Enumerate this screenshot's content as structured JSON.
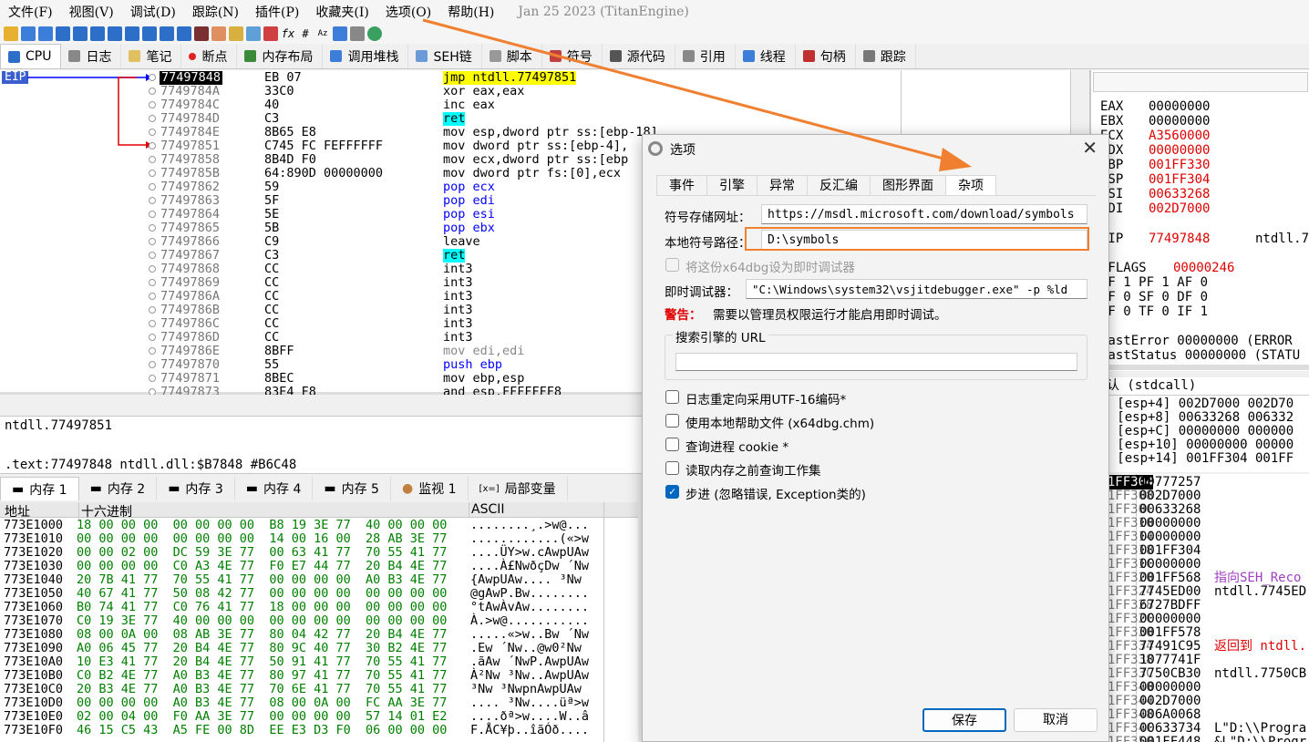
{
  "menu": [
    "文件(F)",
    "视图(V)",
    "调试(D)",
    "跟踪(N)",
    "插件(P)",
    "收藏夹(I)",
    "选项(O)",
    "帮助(H)"
  ],
  "build": "Jan 25 2023 (TitanEngine)",
  "tabs": [
    "CPU",
    "日志",
    "笔记",
    "断点",
    "内存布局",
    "调用堆栈",
    "SEH链",
    "脚本",
    "符号",
    "源代码",
    "引用",
    "线程",
    "句柄",
    "跟踪"
  ],
  "eip_label": "EIP",
  "disasm": [
    {
      "addr": "77497848",
      "bytes": "EB 07",
      "ins": "jmp ntdll.77497851"
    },
    {
      "addr": "7749784A",
      "bytes": "33C0",
      "ins": "xor eax,eax"
    },
    {
      "addr": "7749784C",
      "bytes": "40",
      "ins": "inc eax"
    },
    {
      "addr": "7749784D",
      "bytes": "C3",
      "ins": "ret"
    },
    {
      "addr": "7749784E",
      "bytes": "8B65 E8",
      "ins": "mov esp,dword ptr ss:[ebp-18]"
    },
    {
      "addr": "77497851",
      "bytes": "C745 FC FEFFFFFF",
      "ins": "mov dword ptr ss:[ebp-4],"
    },
    {
      "addr": "77497858",
      "bytes": "8B4D F0",
      "ins": "mov ecx,dword ptr ss:[ebp"
    },
    {
      "addr": "7749785B",
      "bytes": "64:890D 00000000",
      "ins": "mov dword ptr fs:[0],ecx"
    },
    {
      "addr": "77497862",
      "bytes": "59",
      "ins": "pop ecx"
    },
    {
      "addr": "77497863",
      "bytes": "5F",
      "ins": "pop edi"
    },
    {
      "addr": "77497864",
      "bytes": "5E",
      "ins": "pop esi"
    },
    {
      "addr": "77497865",
      "bytes": "5B",
      "ins": "pop ebx"
    },
    {
      "addr": "77497866",
      "bytes": "C9",
      "ins": "leave"
    },
    {
      "addr": "77497867",
      "bytes": "C3",
      "ins": "ret"
    },
    {
      "addr": "77497868",
      "bytes": "CC",
      "ins": "int3"
    },
    {
      "addr": "77497869",
      "bytes": "CC",
      "ins": "int3"
    },
    {
      "addr": "7749786A",
      "bytes": "CC",
      "ins": "int3"
    },
    {
      "addr": "7749786B",
      "bytes": "CC",
      "ins": "int3"
    },
    {
      "addr": "7749786C",
      "bytes": "CC",
      "ins": "int3"
    },
    {
      "addr": "7749786D",
      "bytes": "CC",
      "ins": "int3"
    },
    {
      "addr": "7749786E",
      "bytes": "8BFF",
      "ins": "mov edi,edi"
    },
    {
      "addr": "77497870",
      "bytes": "55",
      "ins": "push ebp"
    },
    {
      "addr": "77497871",
      "bytes": "8BEC",
      "ins": "mov ebp,esp"
    },
    {
      "addr": "77497873",
      "bytes": "83E4 F8",
      "ins": "and esp,FFFFFFF8"
    }
  ],
  "info": {
    "line1": "ntdll.77497851",
    "line2": ".text:77497848 ntdll.dll:$B7848 #B6C48"
  },
  "memtabs": [
    "内存 1",
    "内存 2",
    "内存 3",
    "内存 4",
    "内存 5",
    "监视 1",
    "局部变量"
  ],
  "dump_header": {
    "addr": "地址",
    "hex": "十六进制",
    "ascii": "ASCII"
  },
  "dump": [
    {
      "a": "773E1000",
      "h": "18 00 00 00  00 00 00 00  B8 19 3E 77  40 00 00 00",
      "s": "........¸.>w@..."
    },
    {
      "a": "773E1010",
      "h": "00 00 00 00  00 00 00 00  14 00 16 00  28 AB 3E 77",
      "s": "............(«>w"
    },
    {
      "a": "773E1020",
      "h": "00 00 02 00  DC 59 3E 77  00 63 41 77  70 55 41 77",
      "s": "....ÜY>w.cAwpUAw"
    },
    {
      "a": "773E1030",
      "h": "00 00 00 00  C0 A3 4E 77  F0 E7 44 77  20 B4 4E 77",
      "s": "....À£NwðçDw ´Nw"
    },
    {
      "a": "773E1040",
      "h": "20 7B 41 77  70 55 41 77  00 00 00 00  A0 B3 4E 77",
      "s": " {AwpUAw.... ³Nw"
    },
    {
      "a": "773E1050",
      "h": "40 67 41 77  50 08 42 77  00 00 00 00  00 00 00 00",
      "s": "@gAwP.Bw........"
    },
    {
      "a": "773E1060",
      "h": "B0 74 41 77  C0 76 41 77  18 00 00 00  00 00 00 00",
      "s": "°tAwÀvAw........"
    },
    {
      "a": "773E1070",
      "h": "C0 19 3E 77  40 00 00 00  00 00 00 00  00 00 00 00",
      "s": "À.>w@..........."
    },
    {
      "a": "773E1080",
      "h": "08 00 0A 00  08 AB 3E 77  80 04 42 77  20 B4 4E 77",
      "s": ".....«>w..Bw ´Nw"
    },
    {
      "a": "773E1090",
      "h": "A0 06 45 77  20 B4 4E 77  80 9C 40 77  30 B2 4E 77",
      "s": " .Ew ´Nw..@w0²Nw"
    },
    {
      "a": "773E10A0",
      "h": "10 E3 41 77  20 B4 4E 77  50 91 41 77  70 55 41 77",
      "s": ".ãAw ´NwP.AwpUAw"
    },
    {
      "a": "773E10B0",
      "h": "C0 B2 4E 77  A0 B3 4E 77  80 97 41 77  70 55 41 77",
      "s": "À²Nw ³Nw..AwpUAw"
    },
    {
      "a": "773E10C0",
      "h": "20 B3 4E 77  A0 B3 4E 77  70 6E 41 77  70 55 41 77",
      "s": " ³Nw ³NwpnAwpUAw"
    },
    {
      "a": "773E10D0",
      "h": "00 00 00 00  A0 B3 4E 77  08 00 0A 00  FC AA 3E 77",
      "s": ".... ³Nw....üª>w"
    },
    {
      "a": "773E10E0",
      "h": "02 00 04 00  F0 AA 3E 77  00 00 00 00  57 14 01 E2",
      "s": "....ðª>w....W..â"
    },
    {
      "a": "773E10F0",
      "h": "46 15 C5 43  A5 FE 00 8D  EE E3 D3 F0  06 00 00 00",
      "s": "F.ÅC¥þ..îãÓð...."
    }
  ],
  "regs": [
    {
      "n": "EAX",
      "v": "00000000"
    },
    {
      "n": "EBX",
      "v": "00000000"
    },
    {
      "n": "ECX",
      "v": "A3560000"
    },
    {
      "n": "EDX",
      "v": "00000000"
    },
    {
      "n": "EBP",
      "v": "001FF330"
    },
    {
      "n": "ESP",
      "v": "001FF304"
    },
    {
      "n": "ESI",
      "v": "00633268"
    },
    {
      "n": "EDI",
      "v": "002D7000"
    }
  ],
  "eip": {
    "n": "EIP",
    "v": "77497848",
    "sym": "ntdll.7"
  },
  "eflags": {
    "n": "EFLAGS",
    "v": "00000246"
  },
  "flags": [
    "ZF 1  PF 1  AF 0",
    "OF 0  SF 0  DF 0",
    "CF 0  TF 0  IF 1"
  ],
  "lasterr": [
    "LastError  00000000 (ERROR",
    "LastStatus 00000000 (STATU"
  ],
  "callconv": "默认 (stdcall)",
  "args": [
    "1: [esp+4]  002D7000 002D70",
    "2: [esp+8]  00633268 006332",
    "3: [esp+C]  00000000 000000",
    "4: [esp+10]  00000000 00000",
    "5: [esp+14]  001FF304 001FF"
  ],
  "stack": [
    {
      "a": "001FF304",
      "v": "10777257",
      "c": ""
    },
    {
      "a": "001FF308",
      "v": "002D7000",
      "c": ""
    },
    {
      "a": "001FF30C",
      "v": "00633268",
      "c": ""
    },
    {
      "a": "001FF310",
      "v": "00000000",
      "c": ""
    },
    {
      "a": "001FF314",
      "v": "00000000",
      "c": ""
    },
    {
      "a": "001FF318",
      "v": "001FF304",
      "c": ""
    },
    {
      "a": "001FF31C",
      "v": "00000000",
      "c": ""
    },
    {
      "a": "001FF320",
      "v": "001FF568",
      "c": "指向SEH_Reco"
    },
    {
      "a": "001FF324",
      "v": "7745ED00",
      "c": "ntdll.7745ED"
    },
    {
      "a": "001FF328",
      "v": "6727BDFF",
      "c": ""
    },
    {
      "a": "001FF32C",
      "v": "00000000",
      "c": ""
    },
    {
      "a": "001FF330",
      "v": "001FF578",
      "c": ""
    },
    {
      "a": "001FF334",
      "v": "77491C95",
      "c": "返回到 ntdll."
    },
    {
      "a": "001FF338",
      "v": "1077741F",
      "c": ""
    },
    {
      "a": "001FF33C",
      "v": "7750CB30",
      "c": "ntdll.7750CB"
    },
    {
      "a": "001FF340",
      "v": "00000000",
      "c": ""
    },
    {
      "a": "001FF344",
      "v": "002D7000",
      "c": ""
    },
    {
      "a": "001FF348",
      "v": "006A0068",
      "c": ""
    },
    {
      "a": "001FF34C",
      "v": "00633734",
      "c": "L\"D:\\\\Progra"
    },
    {
      "a": "001FF350",
      "v": "001FF448",
      "c": "&L\"D:\\\\Progr"
    }
  ],
  "dialog": {
    "title": "选项",
    "tabs": [
      "事件",
      "引擎",
      "异常",
      "反汇编",
      "图形界面",
      "杂项"
    ],
    "symstore_label": "符号存储网址：",
    "symstore_value": "https://msdl.microsoft.com/download/symbols",
    "localpath_label": "本地符号路径：",
    "localpath_value": "D:\\symbols",
    "jit_set_label": "将这份x64dbg设为即时调试器",
    "jit_label": "即时调试器：",
    "jit_value": "\"C:\\Windows\\system32\\vsjitdebugger.exe\" -p %ld",
    "warn_label": "警告：",
    "warn_text": "需要以管理员权限运行才能启用即时调试。",
    "search_group": "搜索引擎的 URL",
    "search_value": "",
    "checks": [
      {
        "label": "日志重定向采用UTF-16编码*",
        "on": false
      },
      {
        "label": "使用本地帮助文件 (x64dbg.chm)",
        "on": false
      },
      {
        "label": "查询进程 cookie *",
        "on": false
      },
      {
        "label": "读取内存之前查询工作集",
        "on": false
      },
      {
        "label": "步进 (忽略错误, Exception类的)",
        "on": true
      }
    ],
    "save": "保存",
    "cancel": "取消"
  },
  "colors": {
    "accent": "#0067c0",
    "orange": "#f08030",
    "red": "#e00000"
  }
}
